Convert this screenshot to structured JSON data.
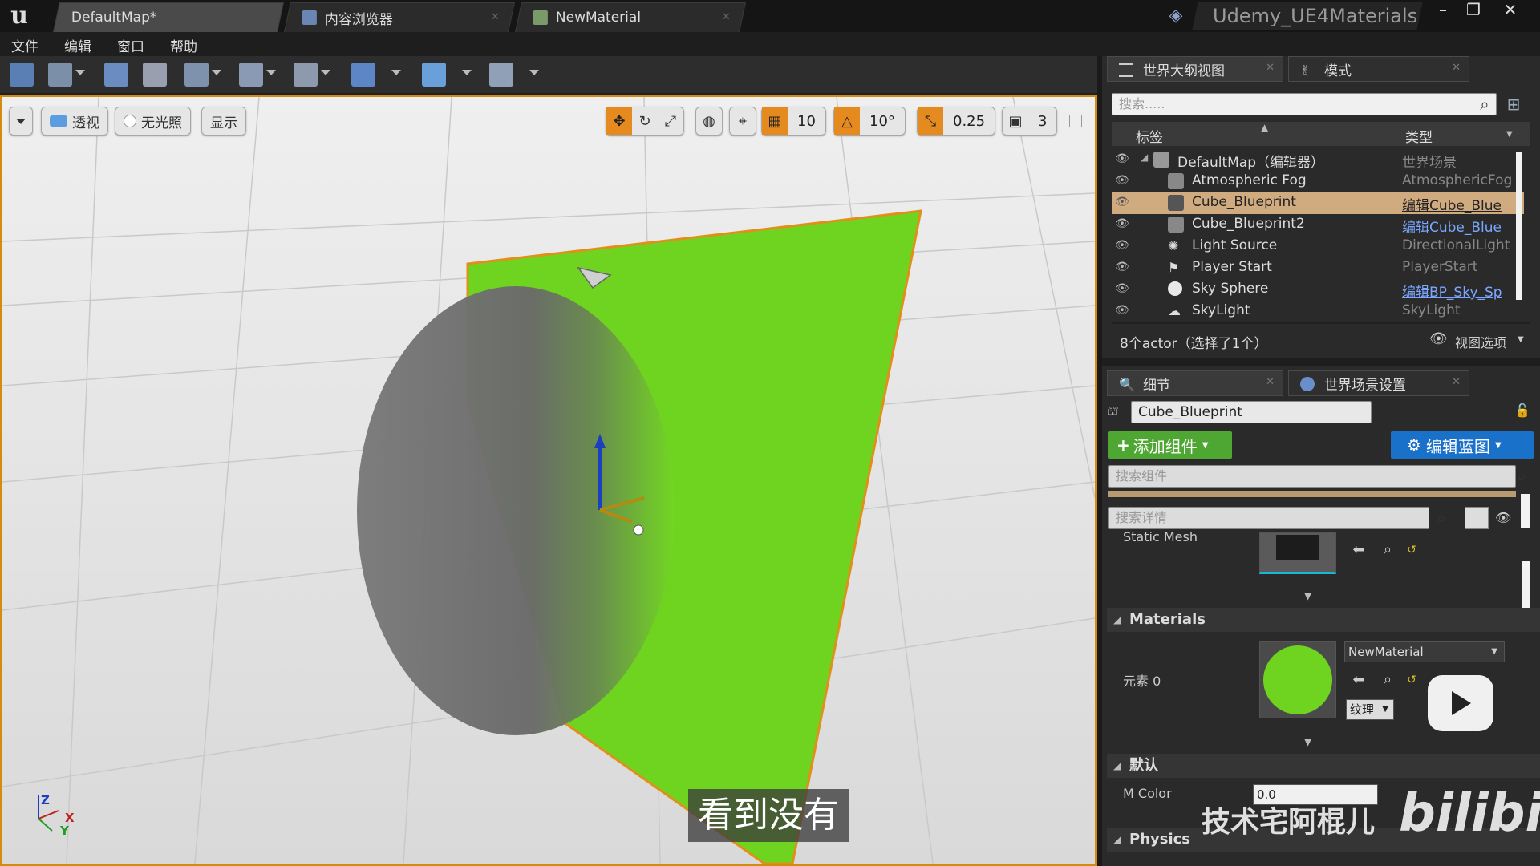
{
  "title_bar": {
    "tabs": [
      {
        "label": "DefaultMap*",
        "active": true
      },
      {
        "label": "内容浏览器",
        "active": false
      },
      {
        "label": "NewMaterial",
        "active": false
      }
    ],
    "project": "Udemy_UE4Materials"
  },
  "menu": [
    "文件",
    "编辑",
    "窗口",
    "帮助"
  ],
  "viewport": {
    "perspective_label": "透视",
    "lighting_label": "无光照",
    "show_label": "显示",
    "grid_snap": "10",
    "rotation_snap": "10°",
    "scale_snap": "0.25",
    "camera_speed": "3",
    "subtitle": "看到没有",
    "axes": {
      "z": "Z",
      "x": "X",
      "y": "Y"
    }
  },
  "outliner": {
    "tab_label": "世界大纲视图",
    "modes_tab_label": "模式",
    "search_placeholder": "搜索.....",
    "col_label": "标签",
    "col_type": "类型",
    "rows": [
      {
        "label": "DefaultMap（编辑器）",
        "type": "世界场景",
        "link": false
      },
      {
        "label": "Atmospheric Fog",
        "type": "AtmosphericFog",
        "link": false
      },
      {
        "label": "Cube_Blueprint",
        "type": "编辑Cube_Blue",
        "link": true
      },
      {
        "label": "Cube_Blueprint2",
        "type": "编辑Cube_Blue",
        "link": true
      },
      {
        "label": "Light Source",
        "type": "DirectionalLight",
        "link": false
      },
      {
        "label": "Player Start",
        "type": "PlayerStart",
        "link": false
      },
      {
        "label": "Sky Sphere",
        "type": "编辑BP_Sky_Sp",
        "link": true
      },
      {
        "label": "SkyLight",
        "type": "SkyLight",
        "link": false
      }
    ],
    "footer_count": "8个actor（选择了1个）",
    "view_options": "视图选项"
  },
  "details": {
    "tab_label": "细节",
    "world_settings_tab_label": "世界场景设置",
    "object_name": "Cube_Blueprint",
    "add_component": "添加组件",
    "edit_blueprint": "编辑蓝图",
    "search_components_placeholder": "搜索组件",
    "search_details_placeholder": "搜索详情",
    "static_mesh_label": "Static Mesh",
    "materials_section": "Materials",
    "element_label": "元素 0",
    "material_name": "NewMaterial",
    "texture_label": "纹理",
    "default_section": "默认",
    "m_color_label": "M Color",
    "m_color_value": "0.0",
    "physics_section": "Physics"
  },
  "watermark": {
    "author": "技术宅阿棍儿",
    "site": "bilibili"
  },
  "colors": {
    "accent_orange": "#e58a1f",
    "selection": "#d1ab80",
    "add_green": "#4ea633",
    "blueprint_blue": "#1a71c9",
    "material_green": "#6fd41f"
  }
}
